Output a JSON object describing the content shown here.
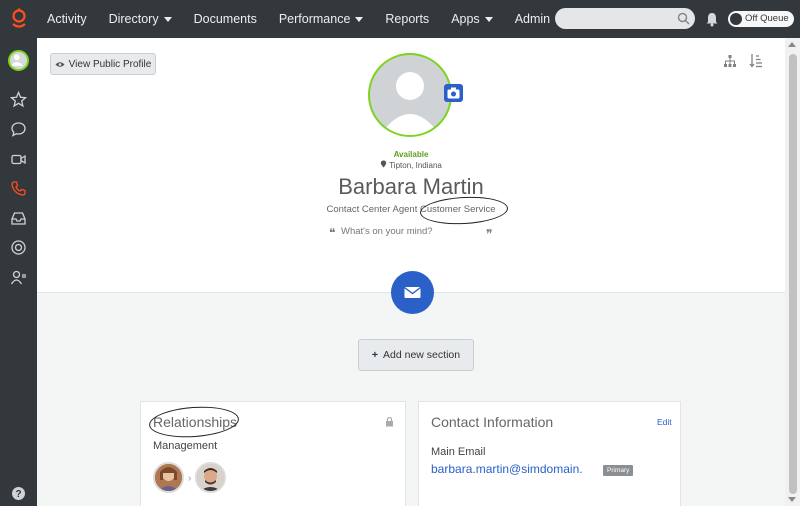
{
  "nav": {
    "items": [
      {
        "label": "Activity",
        "dropdown": false
      },
      {
        "label": "Directory",
        "dropdown": true
      },
      {
        "label": "Documents",
        "dropdown": false
      },
      {
        "label": "Performance",
        "dropdown": true
      },
      {
        "label": "Reports",
        "dropdown": false
      },
      {
        "label": "Apps",
        "dropdown": true
      },
      {
        "label": "Admin",
        "dropdown": false
      }
    ],
    "search_placeholder": "",
    "queue_toggle_label": "Off Queue"
  },
  "sidebar": {
    "icons": [
      "avatar",
      "star-icon",
      "chat-icon",
      "video-icon",
      "phone-icon",
      "inbox-icon",
      "support-icon",
      "user-admin-icon",
      "help-icon"
    ]
  },
  "profile": {
    "view_public_label": "View Public Profile",
    "presence": "Available",
    "location": "Tipton, Indiana",
    "name": "Barbara Martin",
    "job_title": "Contact Center Agent",
    "department": "Customer Service",
    "status_placeholder": "What's on your mind?",
    "add_section_label": "Add new section"
  },
  "relationships": {
    "title": "Relationships",
    "management_label": "Management"
  },
  "contact": {
    "title": "Contact Information",
    "edit_label": "Edit",
    "main_email_label": "Main Email",
    "email": "barbara.martin@simdomain.",
    "primary_badge": "Primary"
  },
  "colors": {
    "nav_bg": "#33383d",
    "accent": "#2a60c8",
    "available": "#7ed321"
  }
}
